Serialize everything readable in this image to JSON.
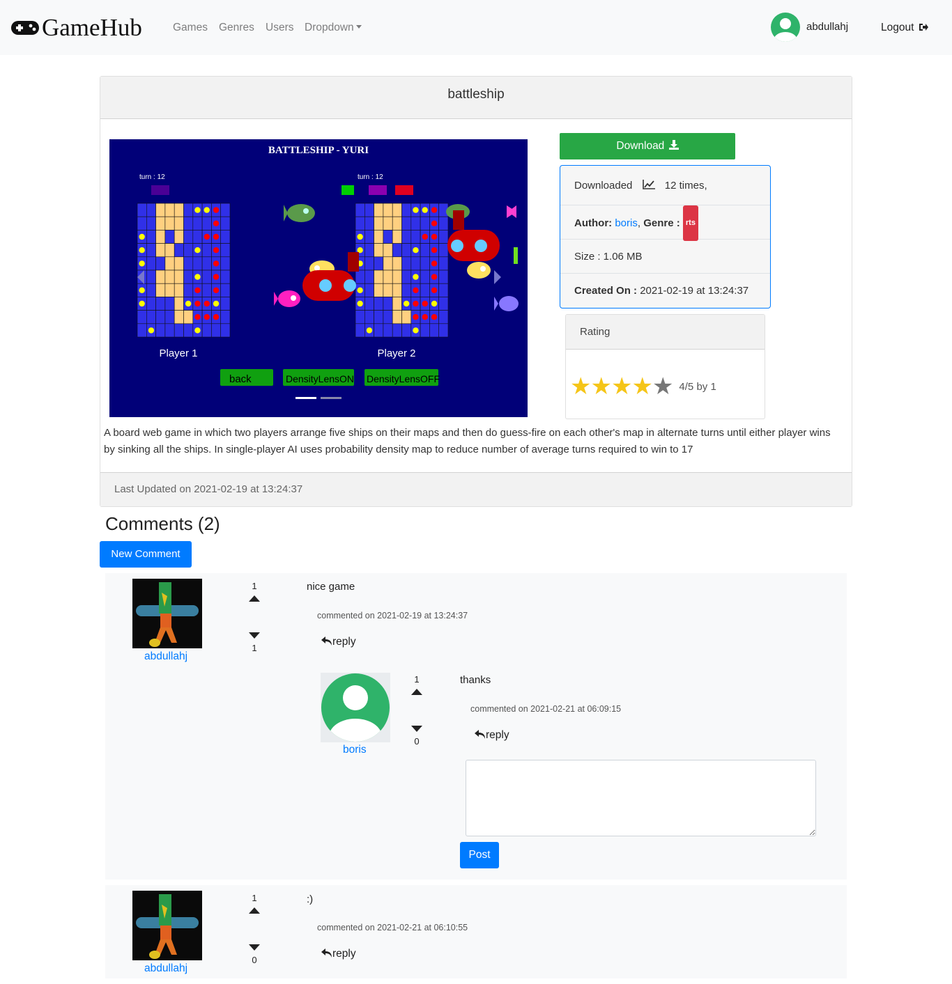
{
  "nav": {
    "brand": "GameHub",
    "links": [
      "Games",
      "Genres",
      "Users",
      "Dropdown"
    ],
    "username": "abdullahj",
    "logout": "Logout"
  },
  "game": {
    "title": "battleship",
    "carousel": {
      "banner": "BATTLESHIP - YURI",
      "turn_left": "turn : 12",
      "turn_right": "turn : 12",
      "player1": "Player 1",
      "player2": "Player 2",
      "buttons": [
        "back",
        "DensityLensON",
        "DensityLensOFF"
      ]
    },
    "download_label": "Download",
    "downloaded_prefix": "Downloaded",
    "downloaded_count": "12 times,",
    "author_label": "Author:",
    "author": "boris",
    "genre_label": "Genre :",
    "genre": "rts",
    "size": "Size : 1.06 MB",
    "created_label": "Created On :",
    "created_value": "2021-02-19 at 13:24:37",
    "rating_title": "Rating",
    "rating_value": 4,
    "rating_max": 5,
    "rating_text": "4/5 by 1",
    "description": "A board web game in which two players arrange five ships on their maps and then do guess-fire on each other's map in alternate turns until either player wins by sinking all the ships. In single-player AI uses probability density map to reduce number of average turns required to win to 17",
    "last_updated": "Last Updated on 2021-02-19 at 13:24:37"
  },
  "comments": {
    "title": "Comments (2)",
    "new_button": "New Comment",
    "items": [
      {
        "user": "abdullahj",
        "up": "1",
        "down": "1",
        "text": "nice game",
        "meta": "commented on 2021-02-19 at 13:24:37",
        "reply": "reply"
      },
      {
        "user": "boris",
        "up": "1",
        "down": "0",
        "text": "thanks",
        "meta": "commented on 2021-02-21 at 06:09:15",
        "reply": "reply"
      },
      {
        "user": "abdullahj",
        "up": "1",
        "down": "0",
        "text": ":)",
        "meta": "commented on 2021-02-21 at 06:10:55",
        "reply": "reply"
      }
    ],
    "post_button": "Post",
    "reply_placeholder": ""
  },
  "colors": {
    "primary": "#007bff",
    "success": "#28a745",
    "danger": "#dc3545",
    "star_filled": "#f5c518",
    "star_empty": "#777777",
    "avatar_green": "#2fb36a",
    "board_bg": "#010078"
  }
}
